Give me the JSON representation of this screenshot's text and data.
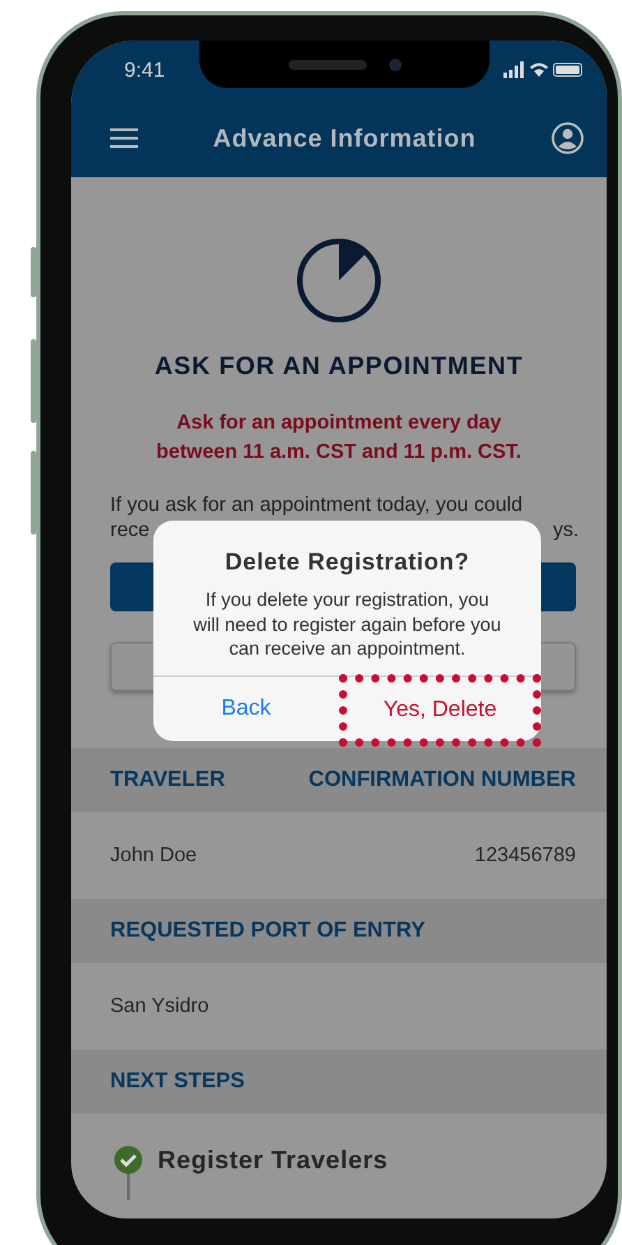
{
  "status_bar": {
    "time": "9:41"
  },
  "header": {
    "title": "Advance Information"
  },
  "intro": {
    "title": "ASK FOR AN APPOINTMENT",
    "notice_lines": [
      "Ask for an appointment every day",
      "between 11 a.m. CST and 11 p.m. CST."
    ],
    "paragraph_line": "If you ask for an appointment today, you could",
    "paragraph_fragments": [
      "rece",
      "ys."
    ]
  },
  "buttons": [
    {
      "kind": "primary"
    },
    {
      "kind": "secondary"
    }
  ],
  "dialog": {
    "title": "Delete Registration?",
    "message": "If you delete your registration, you will need to register again before you can receive an appointment.",
    "actions": [
      {
        "label": "Back",
        "kind": "cancel",
        "highlighted": false
      },
      {
        "label": "Yes, Delete",
        "kind": "destructive",
        "highlighted": true
      }
    ]
  },
  "traveler_table": {
    "columns": [
      "TRAVELER",
      "CONFIRMATION NUMBER"
    ],
    "rows": [
      [
        "John Doe",
        "123456789"
      ]
    ]
  },
  "port": {
    "heading": "REQUESTED PORT OF ENTRY",
    "value": "San Ysidro"
  },
  "next_steps": {
    "heading": "NEXT STEPS",
    "steps": [
      {
        "label": "Register Travelers",
        "done": true
      }
    ]
  }
}
